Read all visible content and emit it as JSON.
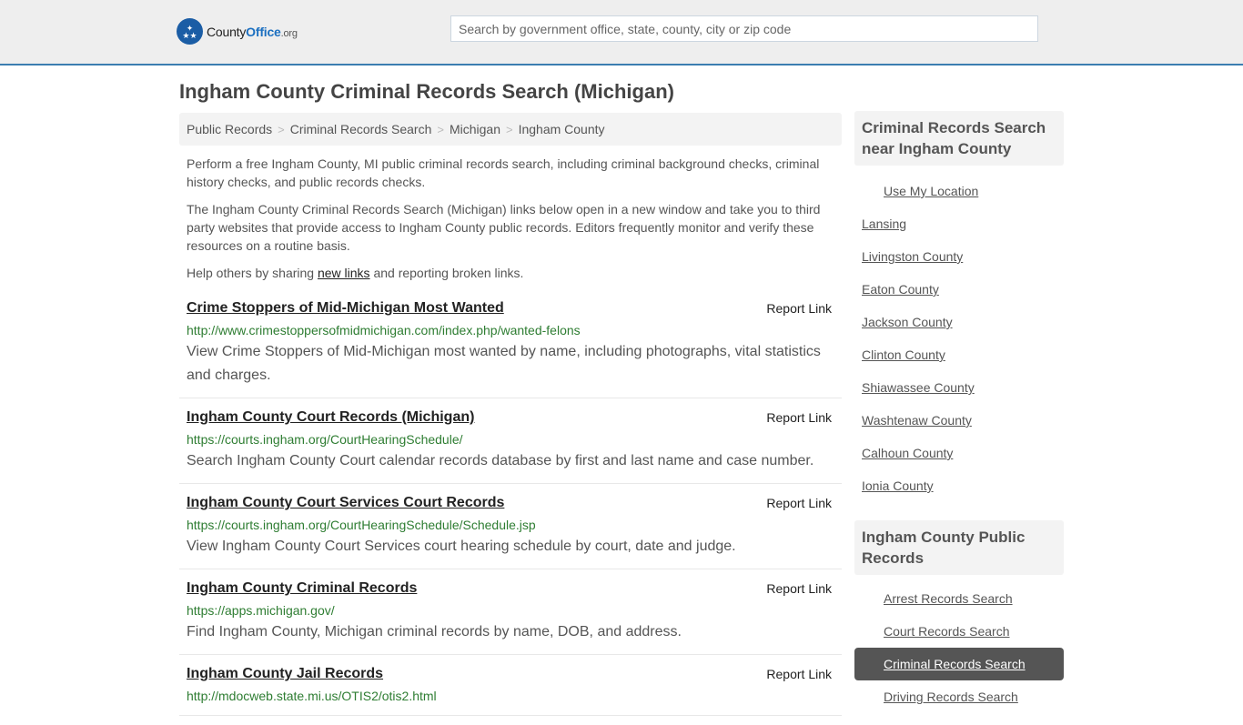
{
  "header": {
    "logo": {
      "icon": "eagle-stars-badge-icon",
      "brand_main": "County",
      "brand_accent": "Office",
      "brand_tld": ".org"
    },
    "search": {
      "placeholder": "Search by government office, state, county, city or zip code",
      "value": ""
    },
    "colors": {
      "accent": "#3b7db0",
      "brand_blue": "#1b5da5",
      "url_green": "#2e7d32"
    }
  },
  "page_title": "Ingham County Criminal Records Search (Michigan)",
  "breadcrumb": [
    {
      "label": "Public Records"
    },
    {
      "label": "Criminal Records Search"
    },
    {
      "label": "Michigan"
    },
    {
      "label": "Ingham County"
    }
  ],
  "breadcrumb_separator": ">",
  "intro": {
    "p1": "Perform a free Ingham County, MI public criminal records search, including criminal background checks, criminal history checks, and public records checks.",
    "p2": "The Ingham County Criminal Records Search (Michigan) links below open in a new window and take you to third party websites that provide access to Ingham County public records. Editors frequently monitor and verify these resources on a routine basis.",
    "p3_before": "Help others by sharing ",
    "p3_link": "new links",
    "p3_after": " and reporting broken links."
  },
  "results": [
    {
      "title": "Crime Stoppers of Mid-Michigan Most Wanted",
      "url": "http://www.crimestoppersofmidmichigan.com/index.php/wanted-felons",
      "desc": "View Crime Stoppers of Mid-Michigan most wanted by name, including photographs, vital statistics and charges.",
      "report": "Report Link"
    },
    {
      "title": "Ingham County Court Records (Michigan)",
      "url": "https://courts.ingham.org/CourtHearingSchedule/",
      "desc": "Search Ingham County Court calendar records database by first and last name and case number.",
      "report": "Report Link"
    },
    {
      "title": "Ingham County Court Services Court Records",
      "url": "https://courts.ingham.org/CourtHearingSchedule/Schedule.jsp",
      "desc": "View Ingham County Court Services court hearing schedule by court, date and judge.",
      "report": "Report Link"
    },
    {
      "title": "Ingham County Criminal Records",
      "url": "https://apps.michigan.gov/",
      "desc": "Find Ingham County, Michigan criminal records by name, DOB, and address.",
      "report": "Report Link"
    },
    {
      "title": "Ingham County Jail Records",
      "url": "http://mdocweb.state.mi.us/OTIS2/otis2.html",
      "desc": "",
      "report": "Report Link"
    }
  ],
  "sidebar": {
    "nearby": {
      "heading": "Criminal Records Search near Ingham County",
      "use_location": "Use My Location",
      "items": [
        "Lansing",
        "Livingston County",
        "Eaton County",
        "Jackson County",
        "Clinton County",
        "Shiawassee County",
        "Washtenaw County",
        "Calhoun County",
        "Ionia County"
      ]
    },
    "public_records": {
      "heading": "Ingham County Public Records",
      "items": [
        {
          "label": "Arrest Records Search",
          "active": false
        },
        {
          "label": "Court Records Search",
          "active": false
        },
        {
          "label": "Criminal Records Search",
          "active": true
        },
        {
          "label": "Driving Records Search",
          "active": false
        }
      ]
    }
  }
}
